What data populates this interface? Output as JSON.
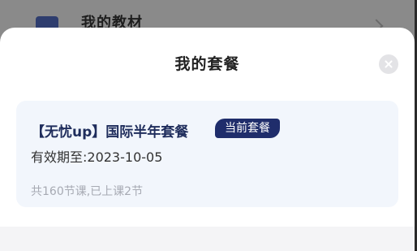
{
  "background": {
    "row_title": "我的教材",
    "row_icon": "book-icon"
  },
  "sheet": {
    "title": "我的套餐",
    "close_icon": "close-icon"
  },
  "plan": {
    "name": "【无忧up】国际半年套餐",
    "badge": "当前套餐",
    "validity": "有效期至:2023-10-05",
    "lessons": "共160节课,已上课2节"
  },
  "colors": {
    "accent": "#1f2d6b",
    "card_bg": "#f2f6fc",
    "overlay": "#7a7a7a"
  }
}
